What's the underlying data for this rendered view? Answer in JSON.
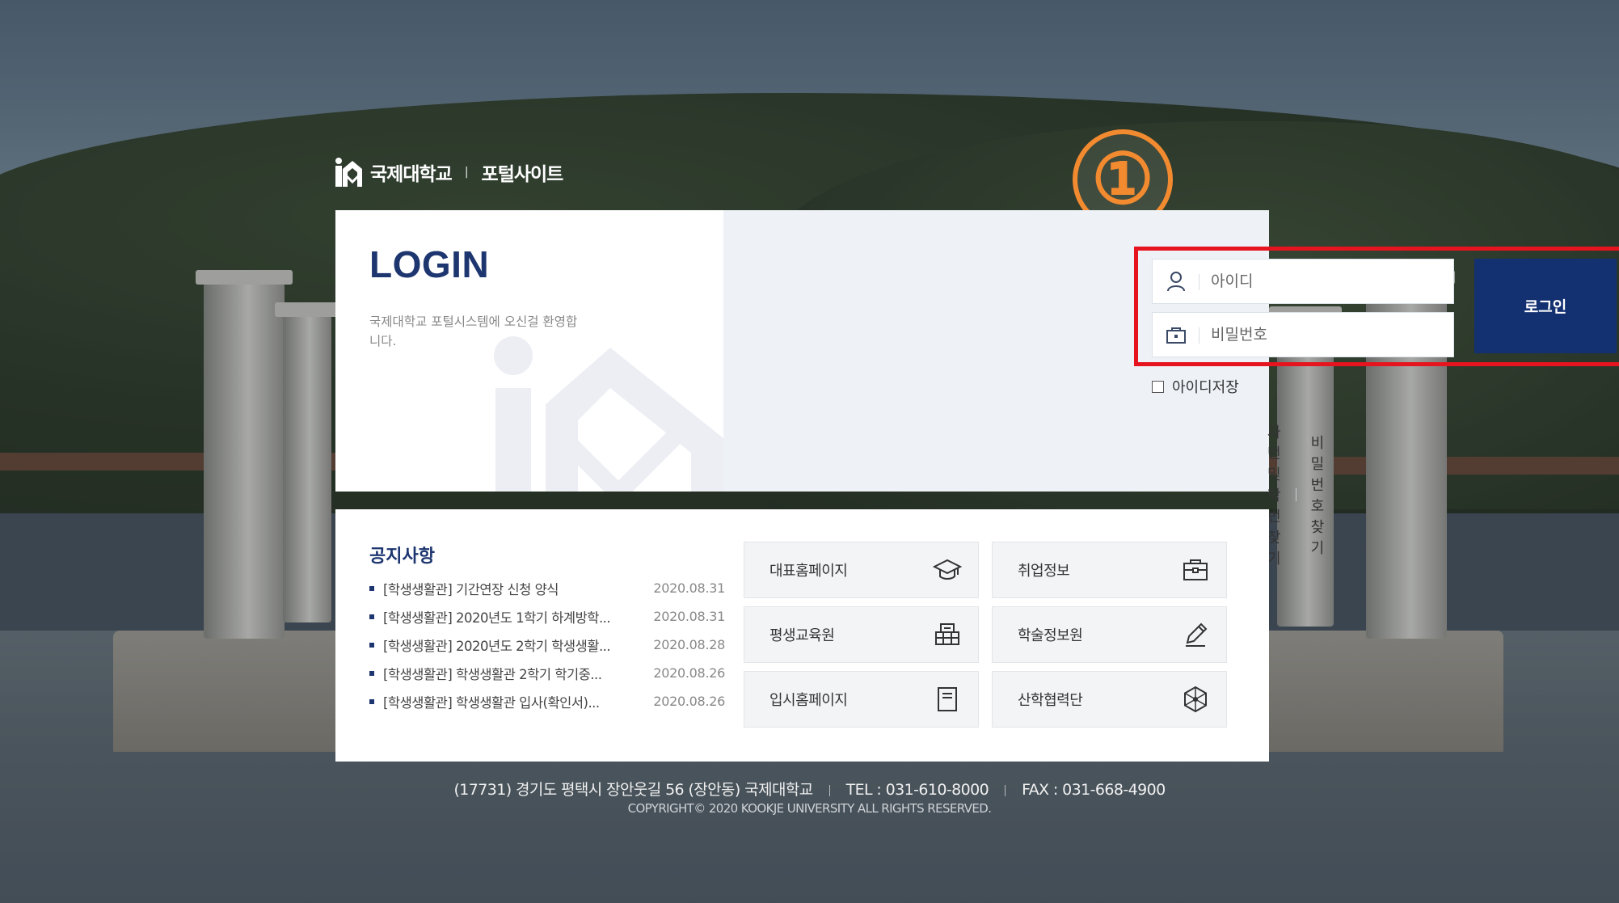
{
  "header": {
    "university_name": "국제대학교",
    "separator": "|",
    "site_name": "포털사이트"
  },
  "annotation": {
    "step_number": "①",
    "accent_color": "#f28a30",
    "highlight_color": "#e5141f"
  },
  "login": {
    "title": "LOGIN",
    "description": "국제대학교 포털시스템에 오신걸 환영합니다.",
    "id_placeholder": "아이디",
    "password_placeholder": "비밀번호",
    "submit_label": "로그인",
    "save_id_label": "아이디저장",
    "find_id_link": "사번 및 학번찾기",
    "find_password_link": "비밀번호 찾기",
    "brand_color": "#133071"
  },
  "notices": {
    "title": "공지사항",
    "items": [
      {
        "text": "[학생생활관] 기간연장 신청 양식",
        "date": "2020.08.31"
      },
      {
        "text": "[학생생활관] 2020년도 1학기 하계방학...",
        "date": "2020.08.31"
      },
      {
        "text": "[학생생활관] 2020년도 2학기 학생생활...",
        "date": "2020.08.28"
      },
      {
        "text": "[학생생활관] 학생생활관 2학기 학기중...",
        "date": "2020.08.26"
      },
      {
        "text": "[학생생활관] 학생생활관 입사(확인서)...",
        "date": "2020.08.26"
      }
    ]
  },
  "quick_links": [
    {
      "label": "대표홈페이지",
      "icon": "graduation-cap-icon"
    },
    {
      "label": "취업정보",
      "icon": "briefcase-icon"
    },
    {
      "label": "평생교육원",
      "icon": "building-icon"
    },
    {
      "label": "학술정보원",
      "icon": "pencil-icon"
    },
    {
      "label": "입시홈페이지",
      "icon": "document-icon"
    },
    {
      "label": "산학협력단",
      "icon": "network-icon"
    }
  ],
  "footer": {
    "address": "(17731) 경기도 평택시 장안웃길 56 (장안동) 국제대학교",
    "tel": "TEL : 031-610-8000",
    "fax": "FAX : 031-668-4900",
    "copyright": "COPYRIGHT© 2020 KOOKJE UNIVERSITY ALL RIGHTS RESERVED."
  }
}
